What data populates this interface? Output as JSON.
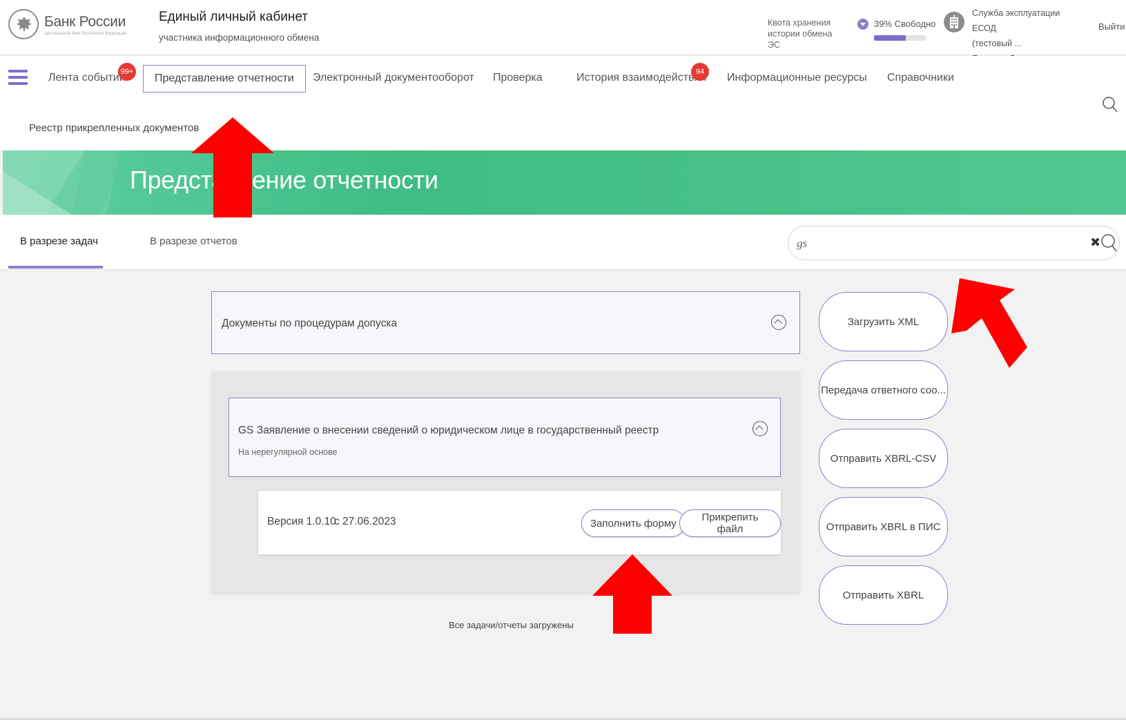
{
  "header": {
    "logo_title": "Банк России",
    "logo_subtitle": "Центральный банк Российской Федерации",
    "app_title": "Единый личный кабинет",
    "app_subtitle": "участника информационного обмена",
    "quota_label": "Квота хранения истории обмена ЭС",
    "quota_free": "39% Свободно",
    "quota_free_fraction": 0.39,
    "org_line1": "Служба эксплуатации ЕСОД",
    "org_line2": "(тестовый ...",
    "org_line3": "Ершаков В.",
    "logout": "Выйти"
  },
  "nav": {
    "items": [
      {
        "label": "Лента событий",
        "badge": "99+"
      },
      {
        "label": "Представление отчетности",
        "active": true
      },
      {
        "label": "Электронный документооборот"
      },
      {
        "label": "Проверка"
      },
      {
        "label": "История взаимодействия",
        "badge": "94"
      },
      {
        "label": "Информационные ресурсы"
      },
      {
        "label": "Справочники"
      }
    ],
    "subnav": "Реестр прикрепленных документов"
  },
  "banner": {
    "title": "Представление отчетности"
  },
  "tabs": {
    "by_tasks": "В разрезе задач",
    "by_reports": "В разрезе отчетов"
  },
  "search": {
    "value": "gs"
  },
  "content": {
    "outer_card_title": "Документы по процедурам допуска",
    "inner_card_title": "GS Заявление о внесении сведений о юридическом лице в государственный реестр",
    "inner_card_sub": "На нерегулярной основе",
    "version": "Версия 1.0.10",
    "version_date": "с 27.06.2023",
    "fill_form": "Заполнить форму",
    "attach_file": "Прикрепить файл",
    "all_loaded": "Все задачи/отчеты загружены"
  },
  "side_buttons": [
    "Загрузить XML",
    "Передача ответного соо...",
    "Отправить XBRL-CSV",
    "Отправить XBRL в ПИС",
    "Отправить XBRL"
  ],
  "colors": {
    "accent": "#8a82cc",
    "banner_green": "#3fbd84",
    "badge_red": "#e53935",
    "arrow_red": "#ff0000"
  }
}
